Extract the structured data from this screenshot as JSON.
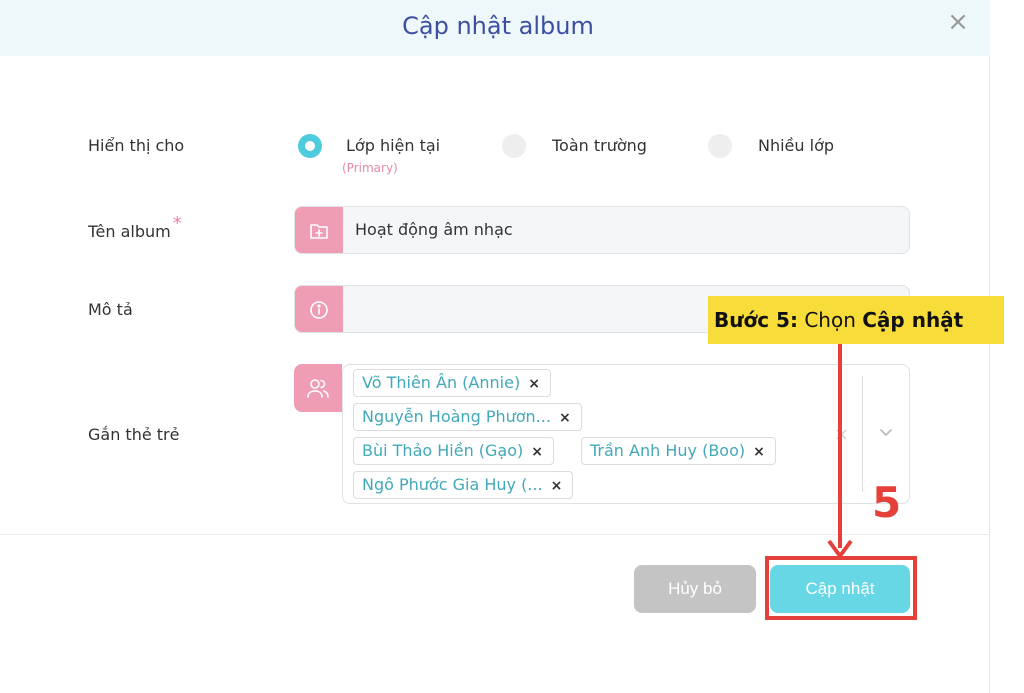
{
  "dialog": {
    "title": "Cập nhật album",
    "close_icon": "×"
  },
  "display_for": {
    "label": "Hiển thị cho",
    "options": [
      {
        "label": "Lớp hiện tại",
        "sub": "(Primary)",
        "selected": true
      },
      {
        "label": "Toàn trường",
        "selected": false
      },
      {
        "label": "Nhiều lớp",
        "selected": false
      }
    ]
  },
  "album_name": {
    "label": "Tên album",
    "required_mark": "*",
    "value": "Hoạt động âm nhạc",
    "icon": "folder-plus-icon"
  },
  "description": {
    "label": "Mô tả",
    "value": "",
    "icon": "info-icon"
  },
  "tag_children": {
    "label": "Gắn thẻ trẻ",
    "icon": "users-icon",
    "tags": [
      "Võ Thiên Ân (Annie)",
      "Nguyễn Hoàng Phươn...",
      "Bùi Thảo Hiền (Gạo)",
      "Trần Anh Huy (Boo)",
      "Ngô Phước Gia Huy (..."
    ],
    "remove_symbol": "×",
    "clear_symbol": "×"
  },
  "buttons": {
    "cancel": "Hủy bỏ",
    "update": "Cập nhật"
  },
  "annotation": {
    "callout_bold_1": "Bước 5:",
    "callout_text": " Chọn ",
    "callout_bold_2": "Cập nhật",
    "step_number": "5",
    "color": "#e5403a"
  },
  "colors": {
    "title": "#3d4fa0",
    "accent": "#4ecbdc",
    "icon_bg": "#ee9db5",
    "tag_text": "#41a9b8",
    "callout_bg": "#f7dc3a"
  }
}
